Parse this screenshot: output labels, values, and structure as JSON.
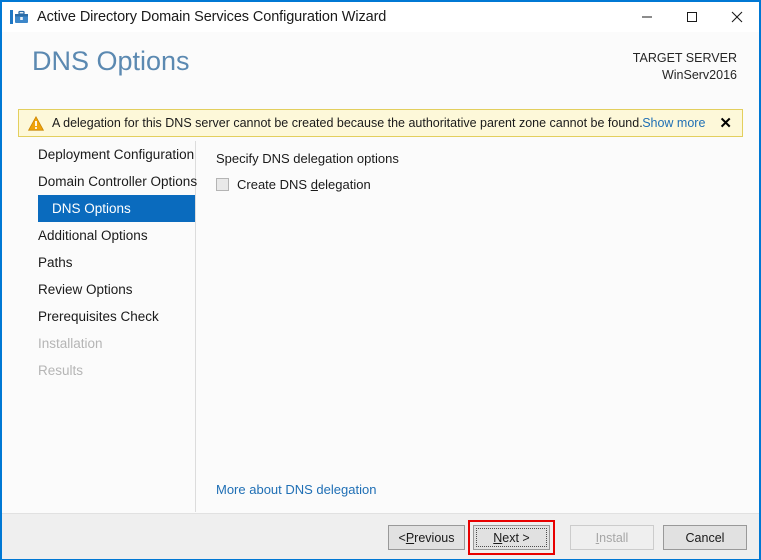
{
  "window": {
    "title": "Active Directory Domain Services Configuration Wizard",
    "app_icon": "server-wizard-icon",
    "controls": {
      "minimize": "minimize-icon",
      "maximize": "maximize-icon",
      "close": "close-icon"
    },
    "border_color": "#0078d4"
  },
  "header": {
    "page_title": "DNS Options",
    "page_title_color": "#5b89b1",
    "target_server_label": "TARGET SERVER",
    "target_server_name": "WinServ2016"
  },
  "warning": {
    "icon": "warning-triangle-icon",
    "message": "A delegation for this DNS server cannot be created because the authoritative parent zone cannot be found...",
    "show_more_label": "Show more",
    "close_label": "✕",
    "background": "#fdf8d9",
    "border": "#e3cf5e",
    "icon_color": "#f0a30a"
  },
  "nav": {
    "items": [
      {
        "label": "Deployment Configuration",
        "state": "enabled"
      },
      {
        "label": "Domain Controller Options",
        "state": "enabled"
      },
      {
        "label": "DNS Options",
        "state": "selected"
      },
      {
        "label": "Additional Options",
        "state": "enabled"
      },
      {
        "label": "Paths",
        "state": "enabled"
      },
      {
        "label": "Review Options",
        "state": "enabled"
      },
      {
        "label": "Prerequisites Check",
        "state": "enabled"
      },
      {
        "label": "Installation",
        "state": "disabled"
      },
      {
        "label": "Results",
        "state": "disabled"
      }
    ],
    "selected_color": "#0a6bbe"
  },
  "content": {
    "section_label": "Specify DNS delegation options",
    "checkbox": {
      "label_before": "Create DNS ",
      "label_accel": "d",
      "label_after": "elegation",
      "checked": false,
      "enabled": false
    },
    "more_link": "More about DNS delegation",
    "link_color": "#1f6fb5"
  },
  "footer": {
    "previous": {
      "before": "< ",
      "accel": "P",
      "after": "revious",
      "enabled": true
    },
    "next": {
      "before": "",
      "accel": "N",
      "after": "ext >",
      "enabled": true,
      "focused": true,
      "highlight_color": "#e80000"
    },
    "install": {
      "before": "",
      "accel": "I",
      "after": "nstall",
      "enabled": false
    },
    "cancel": {
      "before": "",
      "accel": "",
      "after": "Cancel",
      "enabled": true
    }
  }
}
